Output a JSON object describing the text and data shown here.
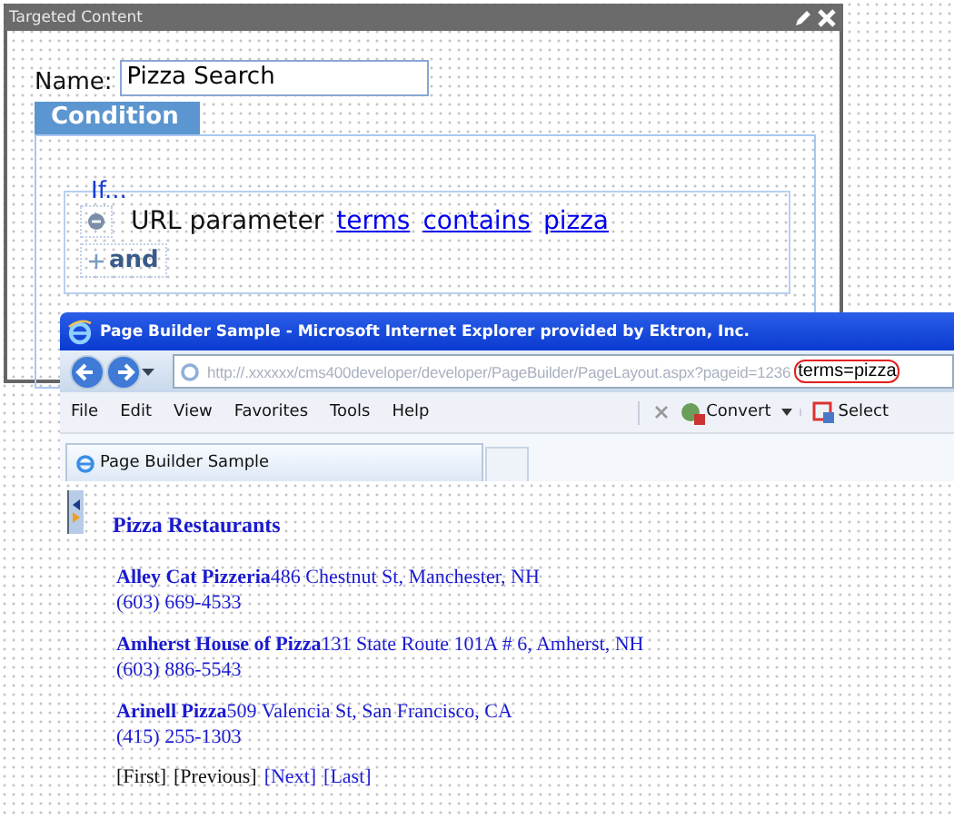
{
  "dialog": {
    "title": "Targeted Content",
    "name_label": "Name:",
    "name_value": "Pizza Search",
    "condition_tab": "Condition",
    "if_label": "If...",
    "rule": {
      "field": "URL parameter",
      "links": [
        "terms",
        "contains",
        "pizza"
      ]
    },
    "add_label": "and"
  },
  "browser": {
    "title": "Page Builder Sample - Microsoft Internet Explorer provided by Ektron, Inc.",
    "url": "http://.xxxxxx/cms400developer/developer/PageBuilder/PageLayout.aspx?pageid=1236",
    "url_highlight": "terms=pizza",
    "menu": [
      "File",
      "Edit",
      "View",
      "Favorites",
      "Tools",
      "Help"
    ],
    "toolbar": [
      "Convert",
      "Select"
    ],
    "tab": "Page Builder Sample",
    "content": {
      "heading": "Pizza Restaurants",
      "results": [
        {
          "name": "Alley Cat Pizzeria",
          "address": "486 Chestnut St, Manchester, NH",
          "phone": "(603) 669-4533"
        },
        {
          "name": "Amherst House of Pizza",
          "address": "131 State Route 101A # 6, Amherst, NH",
          "phone": "(603) 886-5543"
        },
        {
          "name": "Arinell Pizza",
          "address": "509 Valencia St, San Francisco, CA",
          "phone": "(415) 255-1303"
        }
      ],
      "pager": [
        {
          "label": "[First]",
          "enabled": false
        },
        {
          "label": "[Previous]",
          "enabled": false
        },
        {
          "label": "[Next]",
          "enabled": true
        },
        {
          "label": "[Last]",
          "enabled": true
        }
      ]
    }
  }
}
